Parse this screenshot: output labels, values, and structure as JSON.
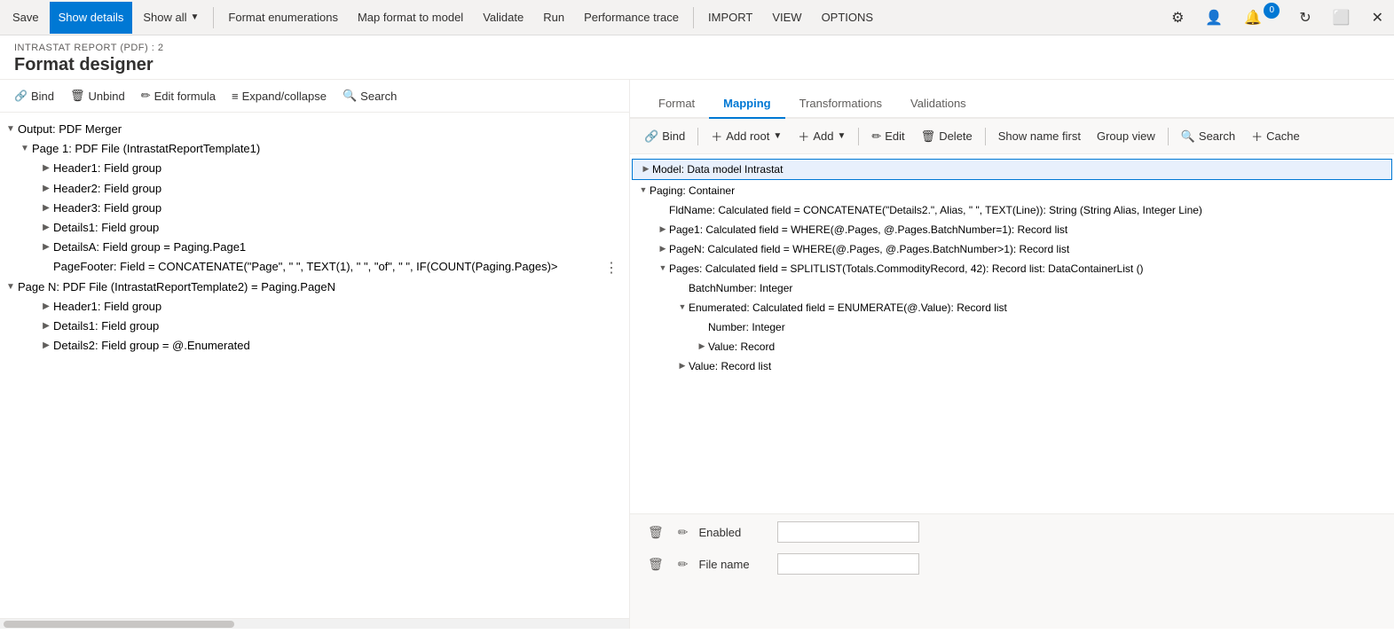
{
  "toolbar": {
    "save": "Save",
    "showDetails": "Show details",
    "showAll": "Show all",
    "formatEnumerations": "Format enumerations",
    "mapFormatToModel": "Map format to model",
    "validate": "Validate",
    "run": "Run",
    "performanceTrace": "Performance trace",
    "import": "IMPORT",
    "view": "VIEW",
    "options": "OPTIONS",
    "notificationCount": "0"
  },
  "page": {
    "breadcrumb": "INTRASTAT REPORT (PDF) : 2",
    "title": "Format designer"
  },
  "leftToolbar": {
    "bind": "Bind",
    "unbind": "Unbind",
    "editFormula": "Edit formula",
    "expandCollapse": "Expand/collapse",
    "search": "Search"
  },
  "leftTree": [
    {
      "id": "output",
      "label": "Output: PDF Merger",
      "level": 0,
      "expanded": true,
      "toggle": "▼"
    },
    {
      "id": "page1",
      "label": "Page 1: PDF File (IntrastatReportTemplate1)",
      "level": 1,
      "expanded": true,
      "toggle": "▼"
    },
    {
      "id": "header1",
      "label": "Header1: Field group",
      "level": 2,
      "expanded": false,
      "toggle": "▶"
    },
    {
      "id": "header2",
      "label": "Header2: Field group",
      "level": 2,
      "expanded": false,
      "toggle": "▶"
    },
    {
      "id": "header3",
      "label": "Header3: Field group",
      "level": 2,
      "expanded": false,
      "toggle": "▶"
    },
    {
      "id": "details1",
      "label": "Details1: Field group",
      "level": 2,
      "expanded": false,
      "toggle": "▶"
    },
    {
      "id": "detailsA",
      "label": "DetailsA: Field group = Paging.Page1",
      "level": 2,
      "expanded": false,
      "toggle": "▶"
    },
    {
      "id": "pageFooter",
      "label": "PageFooter: Field = CONCATENATE(\"Page\", \" \", TEXT(1), \" \", \"of\", \" \", IF(COUNT(Paging.Pages)>",
      "level": 2,
      "expanded": false,
      "toggle": null
    },
    {
      "id": "pageN",
      "label": "Page N: PDF File (IntrastatReportTemplate2) = Paging.PageN",
      "level": 0,
      "expanded": true,
      "toggle": "▼"
    },
    {
      "id": "header1b",
      "label": "Header1: Field group",
      "level": 2,
      "expanded": false,
      "toggle": "▶"
    },
    {
      "id": "details1b",
      "label": "Details1: Field group",
      "level": 2,
      "expanded": false,
      "toggle": "▶"
    },
    {
      "id": "details2",
      "label": "Details2: Field group = @.Enumerated",
      "level": 2,
      "expanded": false,
      "toggle": "▶"
    }
  ],
  "tabs": {
    "format": "Format",
    "mapping": "Mapping",
    "transformations": "Transformations",
    "validations": "Validations"
  },
  "rightToolbar": {
    "bind": "Bind",
    "addRoot": "Add root",
    "add": "Add",
    "edit": "Edit",
    "delete": "Delete",
    "showNameFirst": "Show name first",
    "groupView": "Group view",
    "search": "Search",
    "cache": "Cache"
  },
  "modelTree": [
    {
      "id": "model",
      "label": "Model: Data model Intrastat",
      "level": 0,
      "toggle": "▶",
      "selected": true
    },
    {
      "id": "paging",
      "label": "Paging: Container",
      "level": 0,
      "toggle": "▼",
      "selected": false
    },
    {
      "id": "fldName",
      "label": "FldName: Calculated field = CONCATENATE(\"Details2.\", Alias, \" \", TEXT(Line)): String (String Alias, Integer Line)",
      "level": 1,
      "toggle": null,
      "selected": false
    },
    {
      "id": "page1calc",
      "label": "Page1: Calculated field = WHERE(@.Pages, @.Pages.BatchNumber=1): Record list",
      "level": 1,
      "toggle": "▶",
      "selected": false
    },
    {
      "id": "pageNcalc",
      "label": "PageN: Calculated field = WHERE(@.Pages, @.Pages.BatchNumber>1): Record list",
      "level": 1,
      "toggle": "▶",
      "selected": false
    },
    {
      "id": "pages",
      "label": "Pages: Calculated field = SPLITLIST(Totals.CommodityRecord, 42): Record list: DataContainerList ()",
      "level": 1,
      "toggle": "▼",
      "selected": false
    },
    {
      "id": "batchNumber",
      "label": "BatchNumber: Integer",
      "level": 2,
      "toggle": null,
      "selected": false
    },
    {
      "id": "enumerated",
      "label": "Enumerated: Calculated field = ENUMERATE(@.Value): Record list",
      "level": 2,
      "toggle": "▼",
      "selected": false
    },
    {
      "id": "number",
      "label": "Number: Integer",
      "level": 3,
      "toggle": null,
      "selected": false
    },
    {
      "id": "value",
      "label": "Value: Record",
      "level": 3,
      "toggle": "▶",
      "selected": false
    },
    {
      "id": "valueList",
      "label": "Value: Record list",
      "level": 2,
      "toggle": "▶",
      "selected": false
    }
  ],
  "bottomFields": [
    {
      "label": "Enabled",
      "value": ""
    },
    {
      "label": "File name",
      "value": ""
    }
  ],
  "scrollbar": {
    "visible": true
  }
}
